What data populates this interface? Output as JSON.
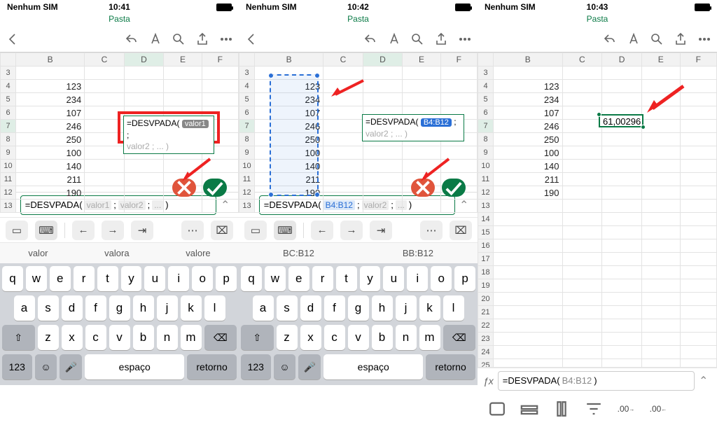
{
  "shots": [
    {
      "status": {
        "carrier": "Nenhum SIM",
        "time": "10:41"
      },
      "title": "Pasta",
      "data_vals": [
        "123",
        "234",
        "107",
        "246",
        "250",
        "100",
        "140",
        "211",
        "190"
      ],
      "rows_start": 3,
      "rows_end": 13,
      "active_row": 7,
      "cell_fx": {
        "pre": "=DESVPADA(",
        "arg1_pill": "valor1",
        "post": " ;",
        "line2": "valor2 ; ... )"
      },
      "fxbar": {
        "pre": "=DESVPADA( ",
        "ghosts": [
          "valor1",
          "valor2",
          "..."
        ],
        "after": " )"
      },
      "suggestions": [
        "valor",
        "valora",
        "valore"
      ],
      "keyboard": {
        "r1": [
          "q",
          "w",
          "e",
          "r",
          "t",
          "y",
          "u",
          "i",
          "o",
          "p"
        ],
        "r2": [
          "a",
          "s",
          "d",
          "f",
          "g",
          "h",
          "j",
          "k",
          "l"
        ],
        "r3_shift": "⇧",
        "r3": [
          "z",
          "x",
          "c",
          "v",
          "b",
          "n",
          "m"
        ],
        "r3_del": "⌫",
        "r4_123": "123",
        "space": "espaço",
        "ret": "retorno"
      }
    },
    {
      "status": {
        "carrier": "Nenhum SIM",
        "time": "10:42"
      },
      "title": "Pasta",
      "data_vals": [
        "123",
        "234",
        "107",
        "246",
        "250",
        "100",
        "140",
        "211",
        "190"
      ],
      "rows_start": 3,
      "rows_end": 13,
      "active_row": 7,
      "cell_fx": {
        "pre": "=DESVPADA(",
        "arg1_pill": "B4:B12",
        "post": " ;",
        "line2": "valor2 ; ... )"
      },
      "fxbar": {
        "pre": "=DESVPADA( ",
        "range": "B4:B12",
        "ghosts": [
          "valor2",
          "..."
        ],
        "after": " )"
      },
      "suggestions": [
        "BC:B12",
        "BB:B12"
      ]
    },
    {
      "status": {
        "carrier": "Nenhum SIM",
        "time": "10:43"
      },
      "title": "Pasta",
      "data_vals": [
        "123",
        "234",
        "107",
        "246",
        "250",
        "100",
        "140",
        "211",
        "190"
      ],
      "rows_start": 3,
      "rows_end": 25,
      "active_row": 7,
      "result": "61,00296",
      "fxbar": {
        "text_pre": "=DESVPADA( ",
        "range": "B4:B12",
        "text_post": " )"
      },
      "bottom_icons": [
        "sheet-icon",
        "row-icon",
        "column-icon",
        "filter-icon",
        "decimal-dec-icon",
        "decimal-inc-icon"
      ],
      "bottom_labels": {
        "dec": ".00↘",
        "inc": ".00↗"
      }
    }
  ],
  "chart_data": {
    "type": "table",
    "title": "Spreadsheet column B values (rows 4–12)",
    "categories": [
      "B4",
      "B5",
      "B6",
      "B7",
      "B8",
      "B9",
      "B10",
      "B11",
      "B12"
    ],
    "values": [
      123,
      234,
      107,
      246,
      250,
      100,
      140,
      211,
      190
    ],
    "formula": "=DESVPADA(B4:B12)",
    "result": 61.00296
  }
}
